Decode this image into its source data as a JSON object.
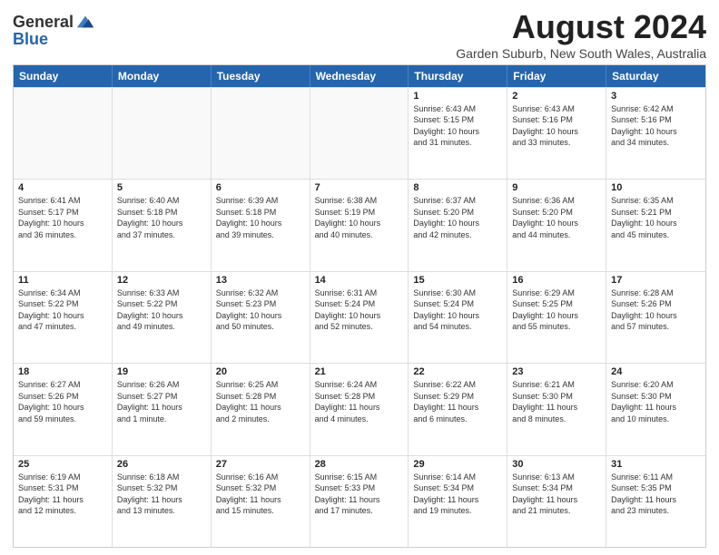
{
  "header": {
    "logo_line1": "General",
    "logo_line2": "Blue",
    "month_year": "August 2024",
    "location": "Garden Suburb, New South Wales, Australia"
  },
  "day_headers": [
    "Sunday",
    "Monday",
    "Tuesday",
    "Wednesday",
    "Thursday",
    "Friday",
    "Saturday"
  ],
  "weeks": [
    [
      {
        "num": "",
        "info": "",
        "empty": true
      },
      {
        "num": "",
        "info": "",
        "empty": true
      },
      {
        "num": "",
        "info": "",
        "empty": true
      },
      {
        "num": "",
        "info": "",
        "empty": true
      },
      {
        "num": "1",
        "info": "Sunrise: 6:43 AM\nSunset: 5:15 PM\nDaylight: 10 hours\nand 31 minutes."
      },
      {
        "num": "2",
        "info": "Sunrise: 6:43 AM\nSunset: 5:16 PM\nDaylight: 10 hours\nand 33 minutes."
      },
      {
        "num": "3",
        "info": "Sunrise: 6:42 AM\nSunset: 5:16 PM\nDaylight: 10 hours\nand 34 minutes."
      }
    ],
    [
      {
        "num": "4",
        "info": "Sunrise: 6:41 AM\nSunset: 5:17 PM\nDaylight: 10 hours\nand 36 minutes."
      },
      {
        "num": "5",
        "info": "Sunrise: 6:40 AM\nSunset: 5:18 PM\nDaylight: 10 hours\nand 37 minutes."
      },
      {
        "num": "6",
        "info": "Sunrise: 6:39 AM\nSunset: 5:18 PM\nDaylight: 10 hours\nand 39 minutes."
      },
      {
        "num": "7",
        "info": "Sunrise: 6:38 AM\nSunset: 5:19 PM\nDaylight: 10 hours\nand 40 minutes."
      },
      {
        "num": "8",
        "info": "Sunrise: 6:37 AM\nSunset: 5:20 PM\nDaylight: 10 hours\nand 42 minutes."
      },
      {
        "num": "9",
        "info": "Sunrise: 6:36 AM\nSunset: 5:20 PM\nDaylight: 10 hours\nand 44 minutes."
      },
      {
        "num": "10",
        "info": "Sunrise: 6:35 AM\nSunset: 5:21 PM\nDaylight: 10 hours\nand 45 minutes."
      }
    ],
    [
      {
        "num": "11",
        "info": "Sunrise: 6:34 AM\nSunset: 5:22 PM\nDaylight: 10 hours\nand 47 minutes."
      },
      {
        "num": "12",
        "info": "Sunrise: 6:33 AM\nSunset: 5:22 PM\nDaylight: 10 hours\nand 49 minutes."
      },
      {
        "num": "13",
        "info": "Sunrise: 6:32 AM\nSunset: 5:23 PM\nDaylight: 10 hours\nand 50 minutes."
      },
      {
        "num": "14",
        "info": "Sunrise: 6:31 AM\nSunset: 5:24 PM\nDaylight: 10 hours\nand 52 minutes."
      },
      {
        "num": "15",
        "info": "Sunrise: 6:30 AM\nSunset: 5:24 PM\nDaylight: 10 hours\nand 54 minutes."
      },
      {
        "num": "16",
        "info": "Sunrise: 6:29 AM\nSunset: 5:25 PM\nDaylight: 10 hours\nand 55 minutes."
      },
      {
        "num": "17",
        "info": "Sunrise: 6:28 AM\nSunset: 5:26 PM\nDaylight: 10 hours\nand 57 minutes."
      }
    ],
    [
      {
        "num": "18",
        "info": "Sunrise: 6:27 AM\nSunset: 5:26 PM\nDaylight: 10 hours\nand 59 minutes."
      },
      {
        "num": "19",
        "info": "Sunrise: 6:26 AM\nSunset: 5:27 PM\nDaylight: 11 hours\nand 1 minute."
      },
      {
        "num": "20",
        "info": "Sunrise: 6:25 AM\nSunset: 5:28 PM\nDaylight: 11 hours\nand 2 minutes."
      },
      {
        "num": "21",
        "info": "Sunrise: 6:24 AM\nSunset: 5:28 PM\nDaylight: 11 hours\nand 4 minutes."
      },
      {
        "num": "22",
        "info": "Sunrise: 6:22 AM\nSunset: 5:29 PM\nDaylight: 11 hours\nand 6 minutes."
      },
      {
        "num": "23",
        "info": "Sunrise: 6:21 AM\nSunset: 5:30 PM\nDaylight: 11 hours\nand 8 minutes."
      },
      {
        "num": "24",
        "info": "Sunrise: 6:20 AM\nSunset: 5:30 PM\nDaylight: 11 hours\nand 10 minutes."
      }
    ],
    [
      {
        "num": "25",
        "info": "Sunrise: 6:19 AM\nSunset: 5:31 PM\nDaylight: 11 hours\nand 12 minutes."
      },
      {
        "num": "26",
        "info": "Sunrise: 6:18 AM\nSunset: 5:32 PM\nDaylight: 11 hours\nand 13 minutes."
      },
      {
        "num": "27",
        "info": "Sunrise: 6:16 AM\nSunset: 5:32 PM\nDaylight: 11 hours\nand 15 minutes."
      },
      {
        "num": "28",
        "info": "Sunrise: 6:15 AM\nSunset: 5:33 PM\nDaylight: 11 hours\nand 17 minutes."
      },
      {
        "num": "29",
        "info": "Sunrise: 6:14 AM\nSunset: 5:34 PM\nDaylight: 11 hours\nand 19 minutes."
      },
      {
        "num": "30",
        "info": "Sunrise: 6:13 AM\nSunset: 5:34 PM\nDaylight: 11 hours\nand 21 minutes."
      },
      {
        "num": "31",
        "info": "Sunrise: 6:11 AM\nSunset: 5:35 PM\nDaylight: 11 hours\nand 23 minutes."
      }
    ]
  ]
}
